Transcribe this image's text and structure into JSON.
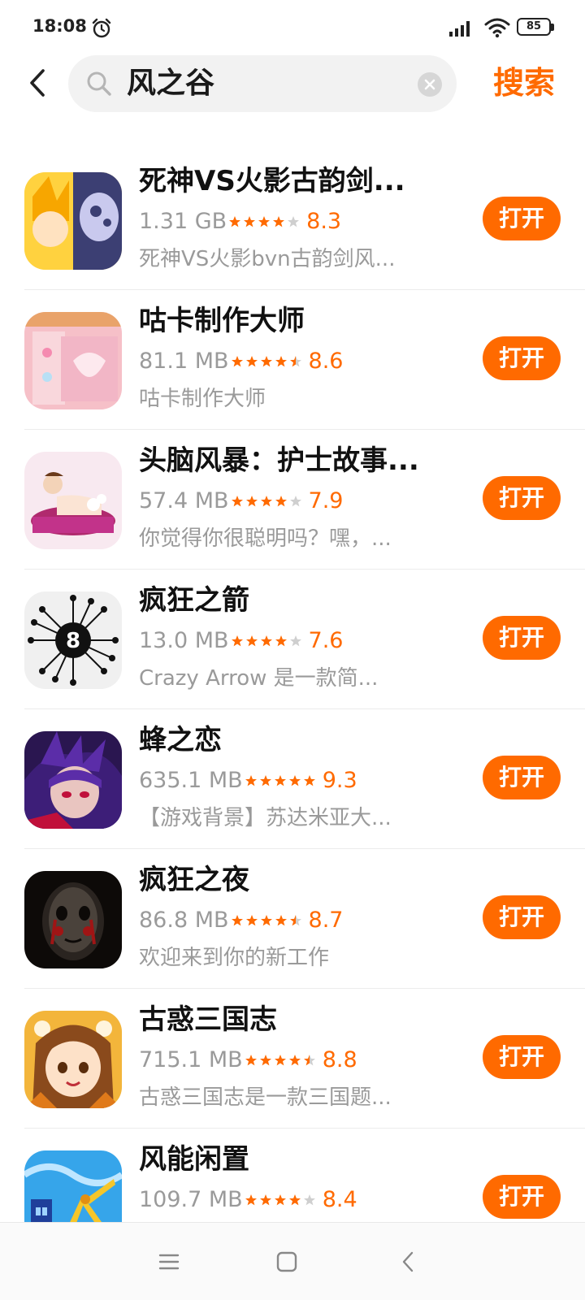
{
  "status_bar": {
    "time": "18:08",
    "battery_level": "85",
    "icons": [
      "alarm-icon",
      "signal-icon",
      "wifi-icon",
      "battery-icon"
    ]
  },
  "header": {
    "back_icon": "chevron-left-icon",
    "search_icon": "search-icon",
    "search_value": "风之谷",
    "clear_icon": "clear-icon",
    "search_button_label": "搜索"
  },
  "colors": {
    "accent": "#ff6a00",
    "muted_text": "#9a9a9a",
    "search_bg": "#f2f2f2"
  },
  "apps": [
    {
      "name": "死神VS火影古韵剑...",
      "size": "1.31 GB",
      "rating": "8.3",
      "stars": 4,
      "description": "死神VS火影bvn古韵剑风...",
      "button": "打开"
    },
    {
      "name": "咕卡制作大师",
      "size": "81.1 MB",
      "rating": "8.6",
      "stars": 4.5,
      "description": "咕卡制作大师",
      "button": "打开"
    },
    {
      "name": "头脑风暴：护士故事...",
      "size": "57.4 MB",
      "rating": "7.9",
      "stars": 4,
      "description": "你觉得你很聪明吗？嘿，...",
      "button": "打开"
    },
    {
      "name": "疯狂之箭",
      "size": "13.0 MB",
      "rating": "7.6",
      "stars": 4,
      "description": "Crazy Arrow 是一款简...",
      "button": "打开"
    },
    {
      "name": "蜂之恋",
      "size": "635.1 MB",
      "rating": "9.3",
      "stars": 5,
      "description": "【游戏背景】苏达米亚大...",
      "button": "打开"
    },
    {
      "name": "疯狂之夜",
      "size": "86.8 MB",
      "rating": "8.7",
      "stars": 4.5,
      "description": "欢迎来到你的新工作",
      "button": "打开"
    },
    {
      "name": "古惑三国志",
      "size": "715.1 MB",
      "rating": "8.8",
      "stars": 4.5,
      "description": "古惑三国志是一款三国题...",
      "button": "打开"
    },
    {
      "name": "风能闲置",
      "size": "109.7 MB",
      "rating": "8.4",
      "stars": 4,
      "description": "",
      "button": "打开"
    }
  ],
  "nav_bar": {
    "items": [
      "menu-icon",
      "home-icon",
      "back-icon"
    ]
  }
}
